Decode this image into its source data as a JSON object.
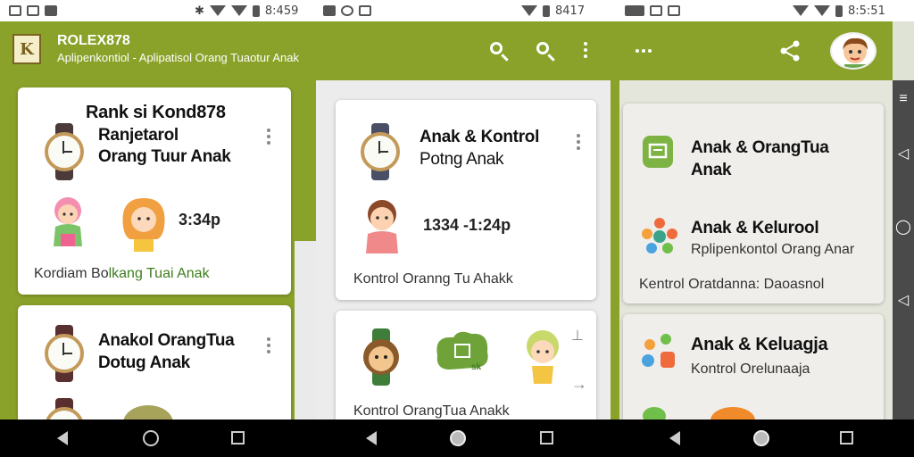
{
  "status_bar": {
    "times": [
      "8:459",
      "8417",
      "8:5:51"
    ]
  },
  "app_bar": {
    "logo_text": "K",
    "title": "ROLEX878",
    "subtitle": "Aplipenkontiol - Aplipatisol Orang Tuaotur Anak"
  },
  "column1": {
    "card1": {
      "heading": "Rank si Kond878",
      "title_line1": "Ranjetarol",
      "title_line2": "Orang Tuur Anak",
      "time": "3:34p",
      "footer_prefix": "Kordiam Bo",
      "footer_green": "lkang Tuai Anak"
    },
    "card2": {
      "title_line1": "Anakol OrangTua",
      "title_line2": "Dotug Anak"
    }
  },
  "column2": {
    "card1": {
      "title_line1": "Anak & Kontrol",
      "title_line2": "Potng Anak",
      "time": "1334 -1:24p",
      "footer": "Kontrol Oranng Tu Ahakk"
    },
    "card2": {
      "footer": "Kontrol OrangTua Anakk",
      "leaf_text": "sk"
    }
  },
  "column3": {
    "card1": {
      "item1_line1": "Anak & OrangTua",
      "item1_line2": "Anak",
      "item2_title": "Anak & Kelurool",
      "item2_sub": "Rplipenkontol Orang Anar",
      "footer": "Kentrol Oratdanna: Daoasnol"
    },
    "card2": {
      "title": "Anak  & Keluagja",
      "sub": "Kontrol Orelunaaja"
    }
  },
  "icons": {
    "accent": "#8aa22a",
    "names": [
      "search-icon",
      "more-vert-icon",
      "more-horiz-icon",
      "share-icon",
      "avatar-icon",
      "watch-icon",
      "back-icon",
      "home-icon",
      "recents-icon"
    ]
  }
}
